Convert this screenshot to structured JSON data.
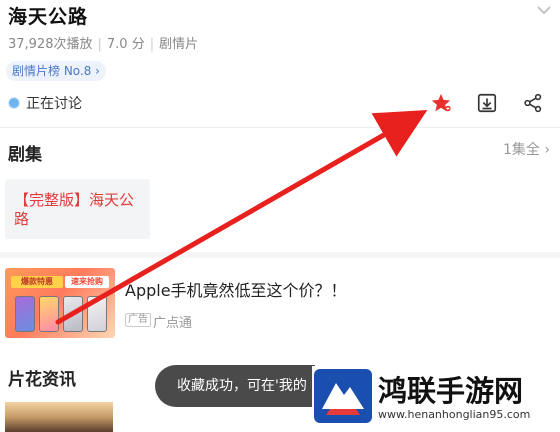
{
  "header": {
    "title": "海天公路",
    "meta_plays": "37,928次播放",
    "meta_score": "7.0 分",
    "meta_genre": "剧情片",
    "rank_chip": "剧情片榜 No.8 ›",
    "discuss_label": "正在讨论"
  },
  "actions": {
    "favorite_icon": "star-icon",
    "download_icon": "download-icon",
    "share_icon": "share-icon",
    "favorite_color": "#e8312f"
  },
  "episodes": {
    "title": "剧集",
    "more_label": "1集全 ›",
    "items": [
      {
        "label": "【完整版】海天公路"
      }
    ]
  },
  "ad": {
    "banner_a": "爆款特惠",
    "banner_b": "速来抢购",
    "title": "Apple手机竟然低至这个价？！",
    "tag": "广告",
    "source": "广点通"
  },
  "news": {
    "title": "片花资讯"
  },
  "toast": {
    "text": "收藏成功，可在'我的"
  },
  "watermark": {
    "text": "鸿联手游网",
    "url": "www.henanhonglian95.com"
  },
  "annotation": {
    "arrow_color": "#e8201e"
  }
}
